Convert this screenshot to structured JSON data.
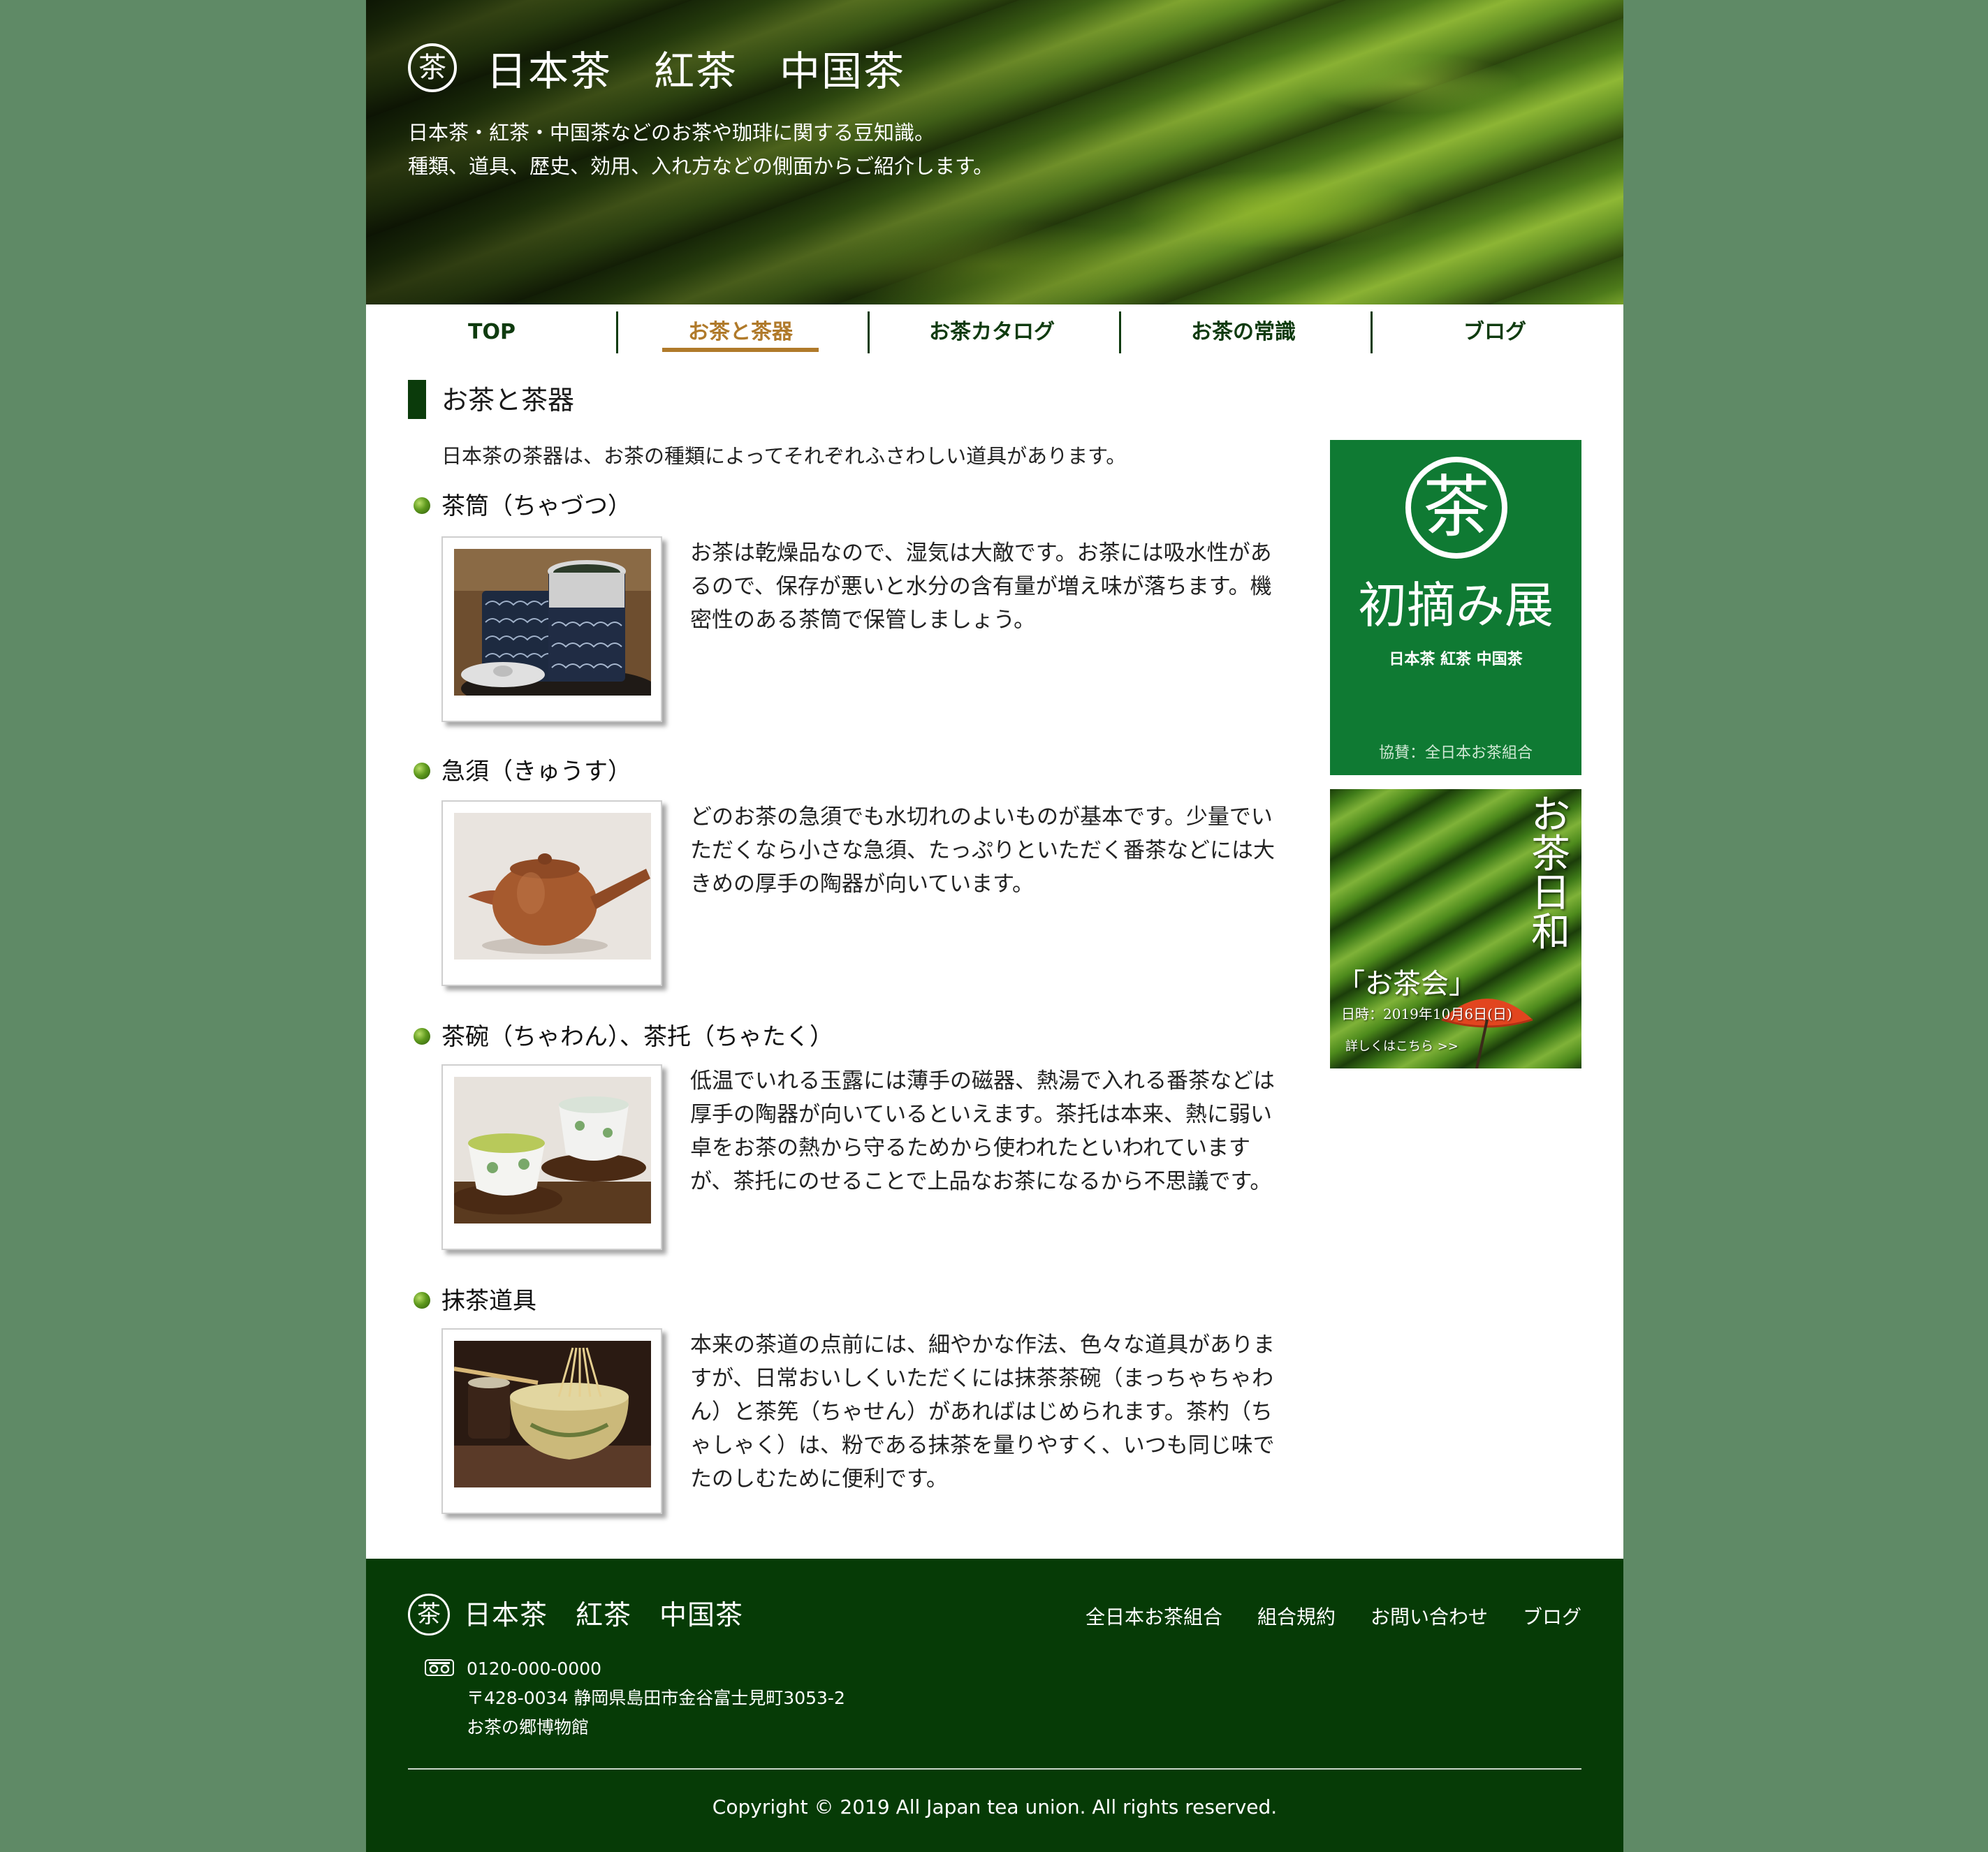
{
  "header": {
    "logo_glyph": "茶",
    "title": "日本茶　紅茶　中国茶",
    "desc_line1": "日本茶・紅茶・中国茶などのお茶や珈琲に関する豆知識。",
    "desc_line2": "種類、道具、歴史、効用、入れ方などの側面からご紹介します。"
  },
  "nav": {
    "items": [
      {
        "label": "TOP"
      },
      {
        "label": "お茶と茶器"
      },
      {
        "label": "お茶カタログ"
      },
      {
        "label": "お茶の常識"
      },
      {
        "label": "ブログ"
      }
    ],
    "active_index": 1
  },
  "main": {
    "section_title": "お茶と茶器",
    "intro": "日本茶の茶器は、お茶の種類によってそれぞれふさわしい道具があります。",
    "items": [
      {
        "title": "茶筒（ちゃづつ）",
        "text": "お茶は乾燥品なので、湿気は大敵です。お茶には吸水性があるので、保存が悪いと水分の含有量が増え味が落ちます。機密性のある茶筒で保管しましょう。"
      },
      {
        "title": "急須（きゅうす）",
        "text": "どのお茶の急須でも水切れのよいものが基本です。少量でいただくなら小さな急須、たっぷりといただく番茶などには大きめの厚手の陶器が向いています。"
      },
      {
        "title": "茶碗（ちゃわん）、茶托（ちゃたく）",
        "text": "低温でいれる玉露には薄手の磁器、熱湯で入れる番茶などは厚手の陶器が向いているといえます。茶托は本来、熱に弱い卓をお茶の熱から守るためから使われたといわれていますが、茶托にのせることで上品なお茶になるから不思議です。"
      },
      {
        "title": "抹茶道具",
        "text": "本来の茶道の点前には、細やかな作法、色々な道具がありますが、日常おいしくいただくには抹茶茶碗（まっちゃちゃわん）と茶筅（ちゃせん）があればはじめられます。茶杓（ちゃしゃく）は、粉である抹茶を量りやすく、いつも同じ味でたのしむために便利です。"
      }
    ]
  },
  "sidebar": {
    "banner1": {
      "glyph": "茶",
      "title": "初摘み展",
      "subtitle": "日本茶 紅茶 中国茶",
      "footer": "協賛：全日本お茶組合"
    },
    "banner2": {
      "vertical_title": "お茶日和",
      "event": "「お茶会」",
      "date": "日時：2019年10月6日(日)",
      "more": "詳しくはこちら >>"
    }
  },
  "footer": {
    "logo_glyph": "茶",
    "title": "日本茶　紅茶　中国茶",
    "links": [
      {
        "label": "全日本お茶組合"
      },
      {
        "label": "組合規約"
      },
      {
        "label": "お問い合わせ"
      },
      {
        "label": "ブログ"
      }
    ],
    "phone": "0120-000-0000",
    "address": "〒428-0034 静岡県島田市金谷富士見町3053-2",
    "venue": "お茶の郷博物館",
    "copyright": "Copyright © 2019 All Japan tea union. All rights reserved."
  },
  "colors": {
    "background": "#5f8a66",
    "primary_dark": "#063b06",
    "nav_text": "#0f3b0f",
    "accent": "#b07a2a",
    "banner_green": "#0f7a33"
  }
}
